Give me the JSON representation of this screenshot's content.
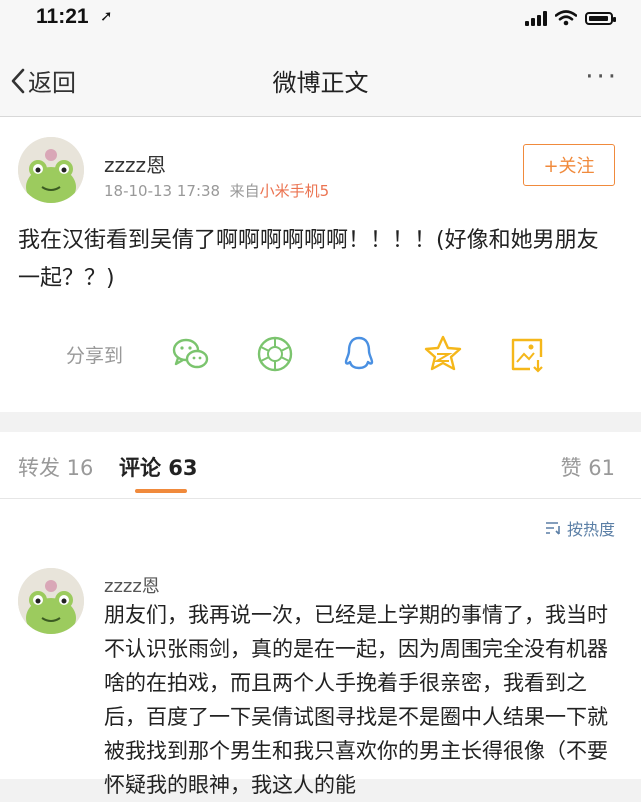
{
  "status_bar": {
    "time": "11:21",
    "location_icon": "location-arrow-icon",
    "signal_icon": "signal-icon",
    "wifi_icon": "wifi-icon",
    "battery_icon": "battery-icon"
  },
  "nav": {
    "back_label": "返回",
    "title": "微博正文",
    "more_label": "···"
  },
  "post": {
    "username": "zzzz恩",
    "time": "18-10-13 17:38",
    "source_prefix": "来自",
    "source": "小米手机5",
    "follow_label": "+关注",
    "text": "我在汉街看到吴倩了啊啊啊啊啊啊！！！！(好像和她男朋友一起？？)",
    "share_label": "分享到",
    "share_icons": [
      "wechat-icon",
      "moments-icon",
      "qq-icon",
      "qzone-icon",
      "save-image-icon"
    ]
  },
  "tabs": {
    "repost_label": "转发 16",
    "comment_label": "评论 63",
    "like_label": "赞 61",
    "sort_label": "按热度"
  },
  "comment": {
    "username": "zzzz恩",
    "text": "朋友们，我再说一次，已经是上学期的事情了，我当时不认识张雨剑，真的是在一起，因为周围完全没有机器啥的在拍戏，而且两个人手挽着手很亲密，我看到之后，百度了一下吴倩试图寻找是不是圈中人结果一下就被我找到那个男生和我只喜欢你的男主长得很像（不要怀疑我的眼神，我这人的能"
  },
  "colors": {
    "accent_orange": "#f08a3c",
    "source_orange": "#eb7350",
    "link_blue": "#5b7fa6",
    "wechat_green": "#7bc46e",
    "qq_blue": "#4a90e2",
    "qzone_yellow": "#f5b71a"
  }
}
